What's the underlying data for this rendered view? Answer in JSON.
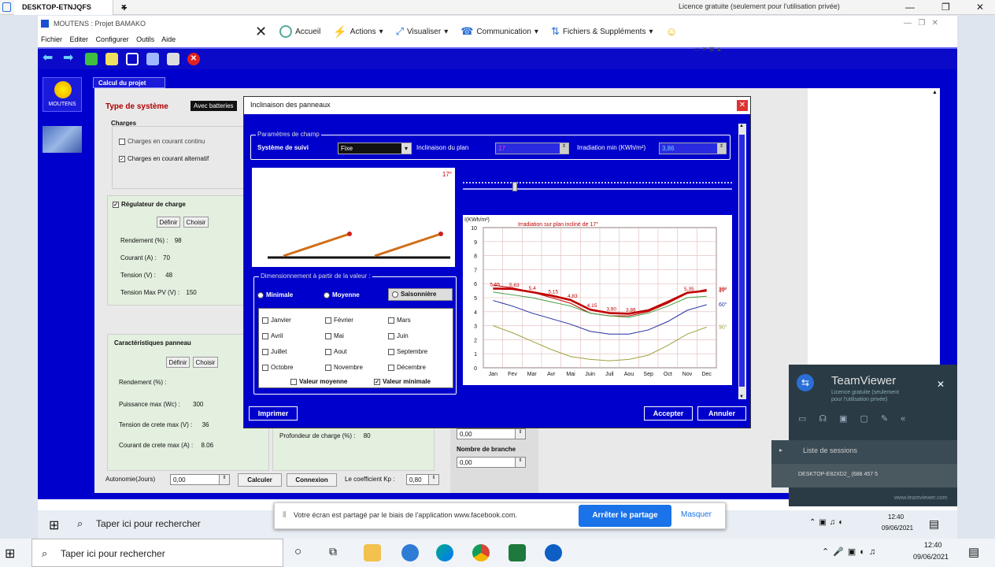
{
  "tv_bar": {
    "tab": "DESKTOP-ETNJQFS",
    "licence": "Licence gratuite (seulement pour l'utilisation privée)"
  },
  "app": {
    "title": "MOUTENS : Projet BAMAKO",
    "menu": [
      "Fichier",
      "Editer",
      "Configurer",
      "Outils",
      "Aide"
    ],
    "commands": [
      "Accueil",
      "Actions",
      "Visualiser",
      "Communication",
      "Fichiers & Suppléments"
    ],
    "logo_text": "MOUTENS",
    "tab": "Calcul du projet"
  },
  "form": {
    "type_label": "Type de système",
    "type_value": "Avec batteries",
    "charges_title": "Charges",
    "charge_cc": "Charges en courant continu",
    "charge_ca": "Charges en courant alternatif",
    "regulateur_title": "Régulateur de charge",
    "definir": "Définir",
    "choisir": "Choisir",
    "rendement": "Rendement (%) :",
    "rendement_val": "98",
    "courant": "Courant (A) :",
    "courant_val": "70",
    "tension": "Tension (V) :",
    "tension_val": "48",
    "tension_max": "Tension Max PV (V) :",
    "tension_max_val": "150",
    "carac_title": "Caractéristiques panneau",
    "rendement2": "Rendement (%) :",
    "puissance": "Puissance max (Wc) :",
    "puissance_val": "300",
    "tension_crete": "Tension de crete max (V) :",
    "tension_crete_val": "36",
    "courant_crete": "Courant de crete max (A) :",
    "courant_crete_val": "8.06",
    "profondeur": "Profondeur de charge (%) :",
    "profondeur_val": "80",
    "field_a": "0,00",
    "nombre_branche": "Nombre de branche",
    "field_b": "0,00",
    "autonomie": "Autonomie(Jours)",
    "autonomie_val": "0,00",
    "calculer": "Calculer",
    "connexion": "Connexion",
    "coef": "Le coefficient Kp :",
    "coef_val": "0,80"
  },
  "dialog": {
    "title": "Inclinaison des panneaux",
    "params_title": "Paramètres de champ",
    "suivi_label": "Système de suivi",
    "suivi_value": "Fixe",
    "inclinaison_label": "Inclinaison du plan",
    "inclinaison_value": "17",
    "irradiation_label": "Irradiation min (KWh/m²)",
    "irradiation_value": "3,86",
    "sketch_angle": "17°",
    "dim_title": "Dimensionnement à partir de la valeur :",
    "radio_min": "Minimale",
    "radio_moy": "Moyenne",
    "radio_sais": "Saisonnière",
    "months": [
      "Janvier",
      "Février",
      "Mars",
      "Avril",
      "Mai",
      "Juin",
      "Juillet",
      "Aout",
      "Septembre",
      "Octobre",
      "Novembre",
      "Décembre"
    ],
    "val_moyenne": "Valeur moyenne",
    "val_minimale": "Valeur minimale",
    "imprimer": "Imprimer",
    "accepter": "Accepter",
    "annuler": "Annuler"
  },
  "chart_data": {
    "type": "line",
    "title": "Irradiation sur plan incliné de 17°",
    "ylabel": "I(KWh/m²)",
    "ylim": [
      0,
      10
    ],
    "categories": [
      "Jan",
      "Fev",
      "Mar",
      "Avr",
      "Mai",
      "Juin",
      "Juil",
      "Aou",
      "Sep",
      "Oct",
      "Nov",
      "Dec"
    ],
    "series": [
      {
        "name": "17°",
        "color": "#c00000",
        "values": [
          5.65,
          5.63,
          5.4,
          5.15,
          4.83,
          4.15,
          3.9,
          3.86,
          4.1,
          4.7,
          5.35,
          5.5
        ],
        "labels": [
          "5,65",
          "5,63",
          "5,4",
          "5,15",
          "4,83",
          "4,15",
          "3,90",
          "3,86",
          "",
          "",
          "5,35",
          ""
        ]
      },
      {
        "name": "30°",
        "color": "#c00000",
        "values": [
          5.9,
          5.7,
          5.4,
          5.0,
          4.6,
          3.9,
          3.7,
          3.7,
          4.0,
          4.6,
          5.3,
          5.6
        ]
      },
      {
        "name": "",
        "color": "#40a040",
        "values": [
          5.4,
          5.2,
          5.0,
          4.7,
          4.4,
          3.9,
          3.7,
          3.6,
          3.9,
          4.4,
          5.0,
          5.1
        ]
      },
      {
        "name": "60°",
        "color": "#2030a0",
        "values": [
          4.8,
          4.4,
          3.9,
          3.5,
          3.1,
          2.6,
          2.4,
          2.4,
          2.7,
          3.3,
          4.1,
          4.5
        ]
      },
      {
        "name": "90°",
        "color": "#a0a040",
        "values": [
          3.0,
          2.5,
          1.9,
          1.3,
          0.8,
          0.6,
          0.5,
          0.6,
          0.9,
          1.6,
          2.4,
          2.9
        ]
      }
    ]
  },
  "teamviewer": {
    "title": "TeamViewer",
    "sub1": "Licence gratuite (seulement",
    "sub2": "pour l'utilisation privée)",
    "sessions": "Liste de sessions",
    "session_item": "DESKTOP-E82XD2_ (688 457 5",
    "link": "www.teamviewer.com"
  },
  "share": {
    "text": "Votre écran est partagé par le biais de l'application www.facebook.com.",
    "stop": "Arrêter le partage",
    "hide": "Masquer"
  },
  "taskbar_remote": {
    "search": "Taper ici pour rechercher",
    "time": "12:40",
    "date": "09/06/2021"
  },
  "taskbar_local": {
    "search": "Taper ici pour rechercher",
    "time": "12:40",
    "date": "09/06/2021"
  }
}
